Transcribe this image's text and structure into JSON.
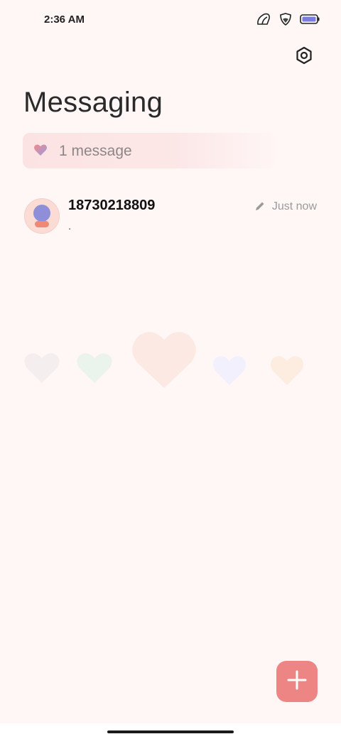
{
  "status_bar": {
    "time": "2:36 AM",
    "icons": [
      "signal-icon",
      "shield-icon",
      "battery-icon"
    ]
  },
  "header": {
    "title": "Messaging",
    "settings_icon": "gear-icon"
  },
  "summary": {
    "text": "1 message",
    "icon": "heart-icon"
  },
  "conversations": [
    {
      "name": "18730218809",
      "preview": ".",
      "timestamp": "Just now",
      "status_icon": "pencil-icon"
    }
  ],
  "fab": {
    "icon": "plus-icon"
  },
  "colors": {
    "background": "#FFF6F6",
    "accent": "#EE8585",
    "banner": "#FCE3E3",
    "avatar_bg": "#FADCD4",
    "avatar_head": "#8E8FD8",
    "avatar_body": "#F08878"
  }
}
